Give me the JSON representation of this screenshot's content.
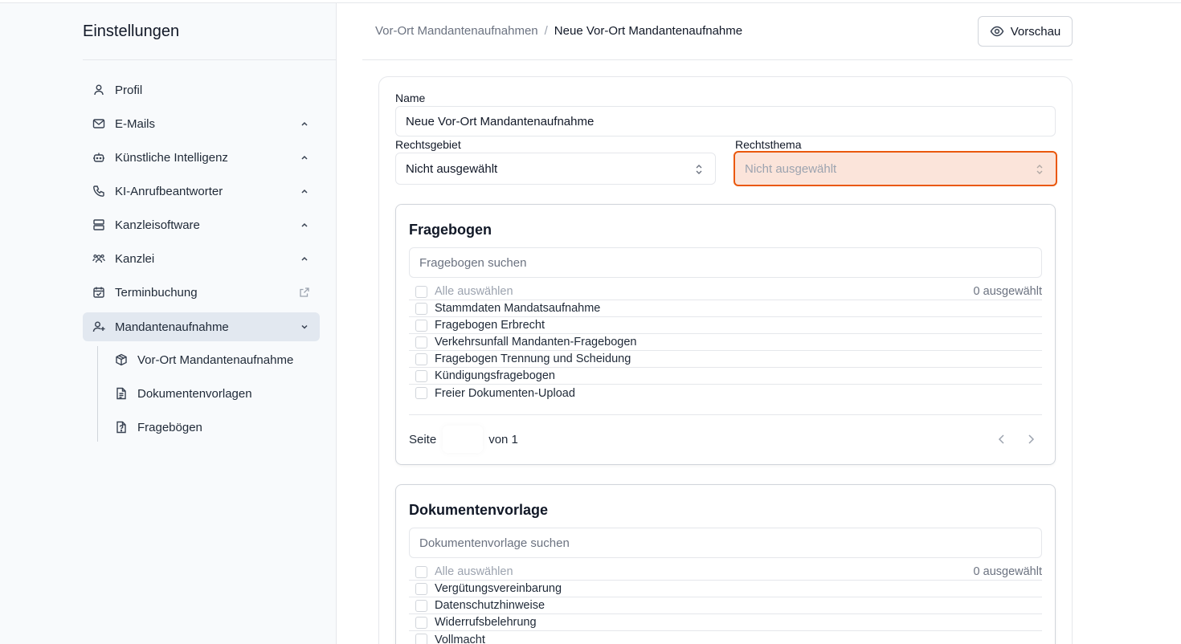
{
  "sidebar": {
    "title": "Einstellungen",
    "items": [
      {
        "label": "Profil"
      },
      {
        "label": "E-Mails"
      },
      {
        "label": "Künstliche Intelligenz"
      },
      {
        "label": "KI-Anrufbeantworter"
      },
      {
        "label": "Kanzleisoftware"
      },
      {
        "label": "Kanzlei"
      },
      {
        "label": "Terminbuchung"
      },
      {
        "label": "Mandantenaufnahme"
      }
    ],
    "sub_items": [
      {
        "label": "Vor-Ort Mandantenaufnahme"
      },
      {
        "label": "Dokumentenvorlagen"
      },
      {
        "label": "Fragebögen"
      }
    ]
  },
  "header": {
    "breadcrumb_parent": "Vor-Ort Mandantenaufnahmen",
    "breadcrumb_sep": "/",
    "breadcrumb_current": "Neue Vor-Ort Mandantenaufnahme",
    "preview_label": "Vorschau"
  },
  "form": {
    "name_label": "Name",
    "name_value": "Neue Vor-Ort Mandantenaufnahme",
    "rechtsgebiet_label": "Rechtsgebiet",
    "rechtsgebiet_value": "Nicht ausgewählt",
    "rechtsthema_label": "Rechtsthema",
    "rechtsthema_value": "Nicht ausgewählt"
  },
  "fragebogen": {
    "title": "Fragebogen",
    "search_placeholder": "Fragebogen suchen",
    "select_all": "Alle auswählen",
    "selected_count": "0 ausgewählt",
    "items": [
      "Stammdaten Mandatsaufnahme",
      "Fragebogen Erbrecht",
      "Verkehrsunfall Mandanten-Fragebogen",
      "Fragebogen Trennung und Scheidung",
      "Kündigungsfragebogen",
      "Freier Dokumenten-Upload"
    ],
    "page_label": "Seite",
    "page_of": "von 1"
  },
  "dokumentenvorlage": {
    "title": "Dokumentenvorlage",
    "search_placeholder": "Dokumentenvorlage suchen",
    "select_all": "Alle auswählen",
    "selected_count": "0 ausgewählt",
    "items": [
      "Vergütungsvereinbarung",
      "Datenschutzhinweise",
      "Widerrufsbelehrung",
      "Vollmacht"
    ]
  },
  "colors": {
    "accent_invalid_border": "#ea580c",
    "accent_invalid_bg": "#fbe4da",
    "sidebar_bg": "#f8fafc",
    "active_item_bg": "#e2e8f0"
  }
}
